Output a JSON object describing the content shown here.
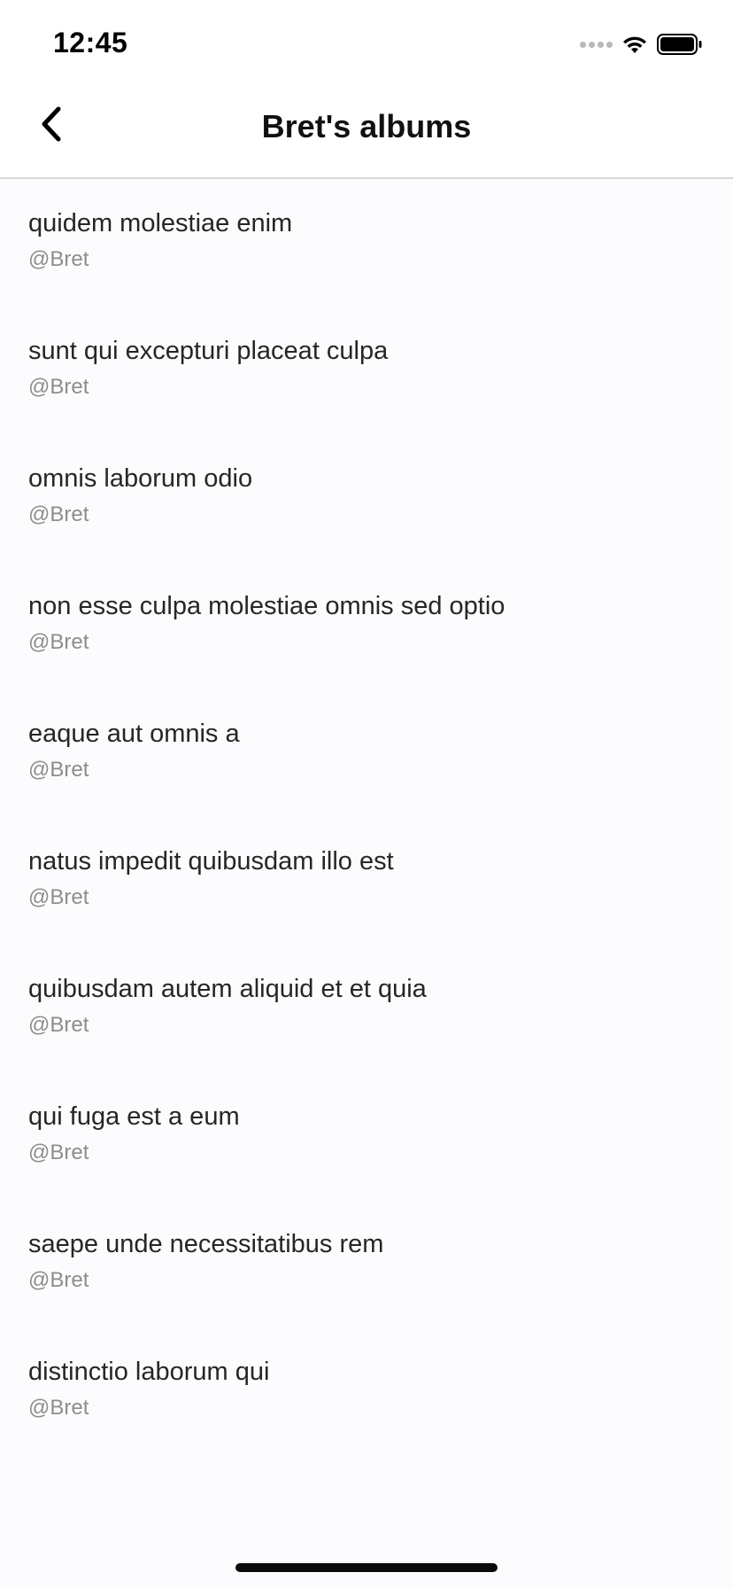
{
  "status_bar": {
    "time": "12:45"
  },
  "nav": {
    "title": "Bret's albums"
  },
  "albums": [
    {
      "title": "quidem molestiae enim",
      "subtitle": "@Bret"
    },
    {
      "title": "sunt qui excepturi placeat culpa",
      "subtitle": "@Bret"
    },
    {
      "title": "omnis laborum odio",
      "subtitle": "@Bret"
    },
    {
      "title": "non esse culpa molestiae omnis sed optio",
      "subtitle": "@Bret"
    },
    {
      "title": "eaque aut omnis a",
      "subtitle": "@Bret"
    },
    {
      "title": "natus impedit quibusdam illo est",
      "subtitle": "@Bret"
    },
    {
      "title": "quibusdam autem aliquid et et quia",
      "subtitle": "@Bret"
    },
    {
      "title": "qui fuga est a eum",
      "subtitle": "@Bret"
    },
    {
      "title": "saepe unde necessitatibus rem",
      "subtitle": "@Bret"
    },
    {
      "title": "distinctio laborum qui",
      "subtitle": "@Bret"
    }
  ],
  "icons": {
    "back": "chevron-left-icon",
    "signal": "cellular-signal-icon",
    "wifi": "wifi-icon",
    "battery": "battery-icon"
  }
}
